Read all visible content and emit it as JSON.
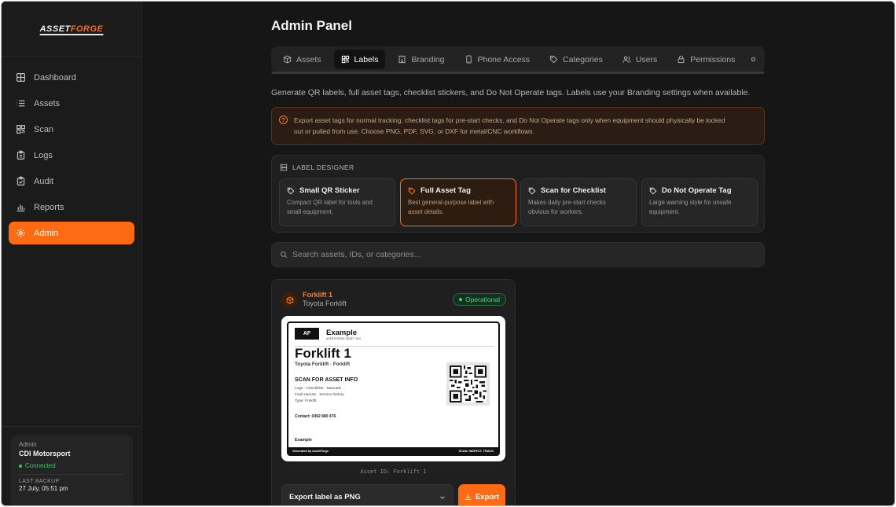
{
  "brand": {
    "logo_part1": "ASSET",
    "logo_part2": "FORGE",
    "accent_color": "#ff6a13"
  },
  "sidebar": {
    "items": [
      {
        "label": "Dashboard",
        "icon": "grid-icon"
      },
      {
        "label": "Assets",
        "icon": "list-icon"
      },
      {
        "label": "Scan",
        "icon": "qr-icon"
      },
      {
        "label": "Logs",
        "icon": "clipboard-icon"
      },
      {
        "label": "Audit",
        "icon": "clipboard-check-icon"
      },
      {
        "label": "Reports",
        "icon": "bar-chart-icon"
      },
      {
        "label": "Admin",
        "icon": "gear-icon",
        "active": true
      }
    ],
    "status": {
      "role": "Admin",
      "org": "CDI Motorsport",
      "connection": "Connected",
      "backup_label": "LAST BACKUP",
      "backup_time": "27 July, 05:51 pm"
    }
  },
  "main": {
    "title": "Admin Panel",
    "tabs": [
      {
        "label": "Assets",
        "icon": "box-icon"
      },
      {
        "label": "Labels",
        "icon": "qr-icon",
        "active": true
      },
      {
        "label": "Branding",
        "icon": "building-icon"
      },
      {
        "label": "Phone Access",
        "icon": "phone-icon"
      },
      {
        "label": "Categories",
        "icon": "tag-icon"
      },
      {
        "label": "Users",
        "icon": "users-icon"
      },
      {
        "label": "Permissions",
        "icon": "lock-icon"
      }
    ],
    "description": "Generate QR labels, full asset tags, checklist stickers, and Do Not Operate tags. Labels use your Branding settings when available.",
    "notice": {
      "line1": "Export asset tags for normal tracking, checklist tags for pre-start checks, and Do Not Operate tags only when equipment should physically be locked",
      "line2": "out or pulled from use. Choose PNG, PDF, SVG, or DXF for metal/CNC workflows."
    },
    "designer": {
      "title": "LABEL DESIGNER",
      "cards": [
        {
          "title": "Small QR Sticker",
          "desc1": "Compact QR label for tools and",
          "desc2": "small equipment."
        },
        {
          "title": "Full Asset Tag",
          "desc1": "Best general-purpose label with",
          "desc2": "asset details.",
          "active": true
        },
        {
          "title": "Scan for Checklist",
          "desc1": "Makes daily pre-start checks",
          "desc2": "obvious for workers."
        },
        {
          "title": "Do Not Operate Tag",
          "desc1": "Large warning style for unsafe",
          "desc2": "equipment."
        }
      ]
    },
    "search": {
      "placeholder": "Search assets, IDs, or categories..."
    },
    "asset": {
      "name": "Forklift 1",
      "model": "Toyota Forklift",
      "status": "Operational",
      "label_preview": {
        "badge": "AF",
        "brand": "Example",
        "brand_sub": "ASSETFORGE ASSET TAG",
        "title": "Forklift 1",
        "subtitle": "Toyota Forklift · Forklift",
        "scan_heading": "SCAN FOR ASSET INFO",
        "info_line1": "Logs · Checklists · Manuals",
        "info_line2": "Fault reports · Service history",
        "info_line3": "Type: Forklift",
        "contact": "Contact: 0492 880 476",
        "footer_brand": "Example",
        "bar_left": "Generated by AssetForge",
        "bar_right": "SCAN. INSPECT. TRACK."
      },
      "asset_id": "Asset ID: Forklift 1",
      "export_option": "Export label as PNG",
      "export_button": "Export"
    }
  }
}
